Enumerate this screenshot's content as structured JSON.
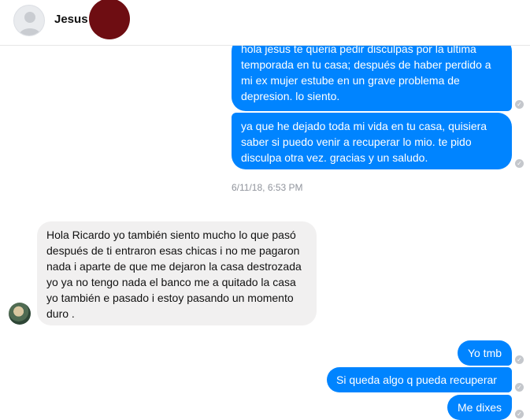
{
  "header": {
    "contact_name": "Jesus"
  },
  "messages": [
    {
      "id": "m1",
      "direction": "outgoing",
      "text": "hola jesus te queria pedir disculpas por la ultima temporada en tu casa; después de haber perdido a mi ex mujer estube en un grave problema de depresion. lo siento."
    },
    {
      "id": "m2",
      "direction": "outgoing",
      "text": "ya que he dejado toda mi vida en tu casa, quisiera saber si puedo venir a recuperar lo mio. te pido disculpa otra vez. gracias y un saludo."
    },
    {
      "id": "m3",
      "direction": "incoming",
      "text": "Hola Ricardo yo también siento mucho lo que pasó después de ti entraron esas chicas i no me pagaron nada i aparte de que me dejaron la casa destrozada yo ya no tengo nada el banco me a quitado la casa yo también   e pasado i estoy pasando un momento duro ."
    },
    {
      "id": "m4",
      "direction": "outgoing",
      "text": "Yo tmb"
    },
    {
      "id": "m5",
      "direction": "outgoing",
      "text": "Si queda algo q pueda recuperar"
    },
    {
      "id": "m6",
      "direction": "outgoing",
      "text": "Me dixes"
    }
  ],
  "timestamp": "6/11/18, 6:53 PM",
  "icons": {
    "seen_check": "check-circle-icon",
    "contact_avatar": "default-avatar-icon"
  },
  "colors": {
    "outgoing_bubble": "#0084ff",
    "incoming_bubble": "#f1f0f0",
    "redaction": "#6e0d12"
  }
}
